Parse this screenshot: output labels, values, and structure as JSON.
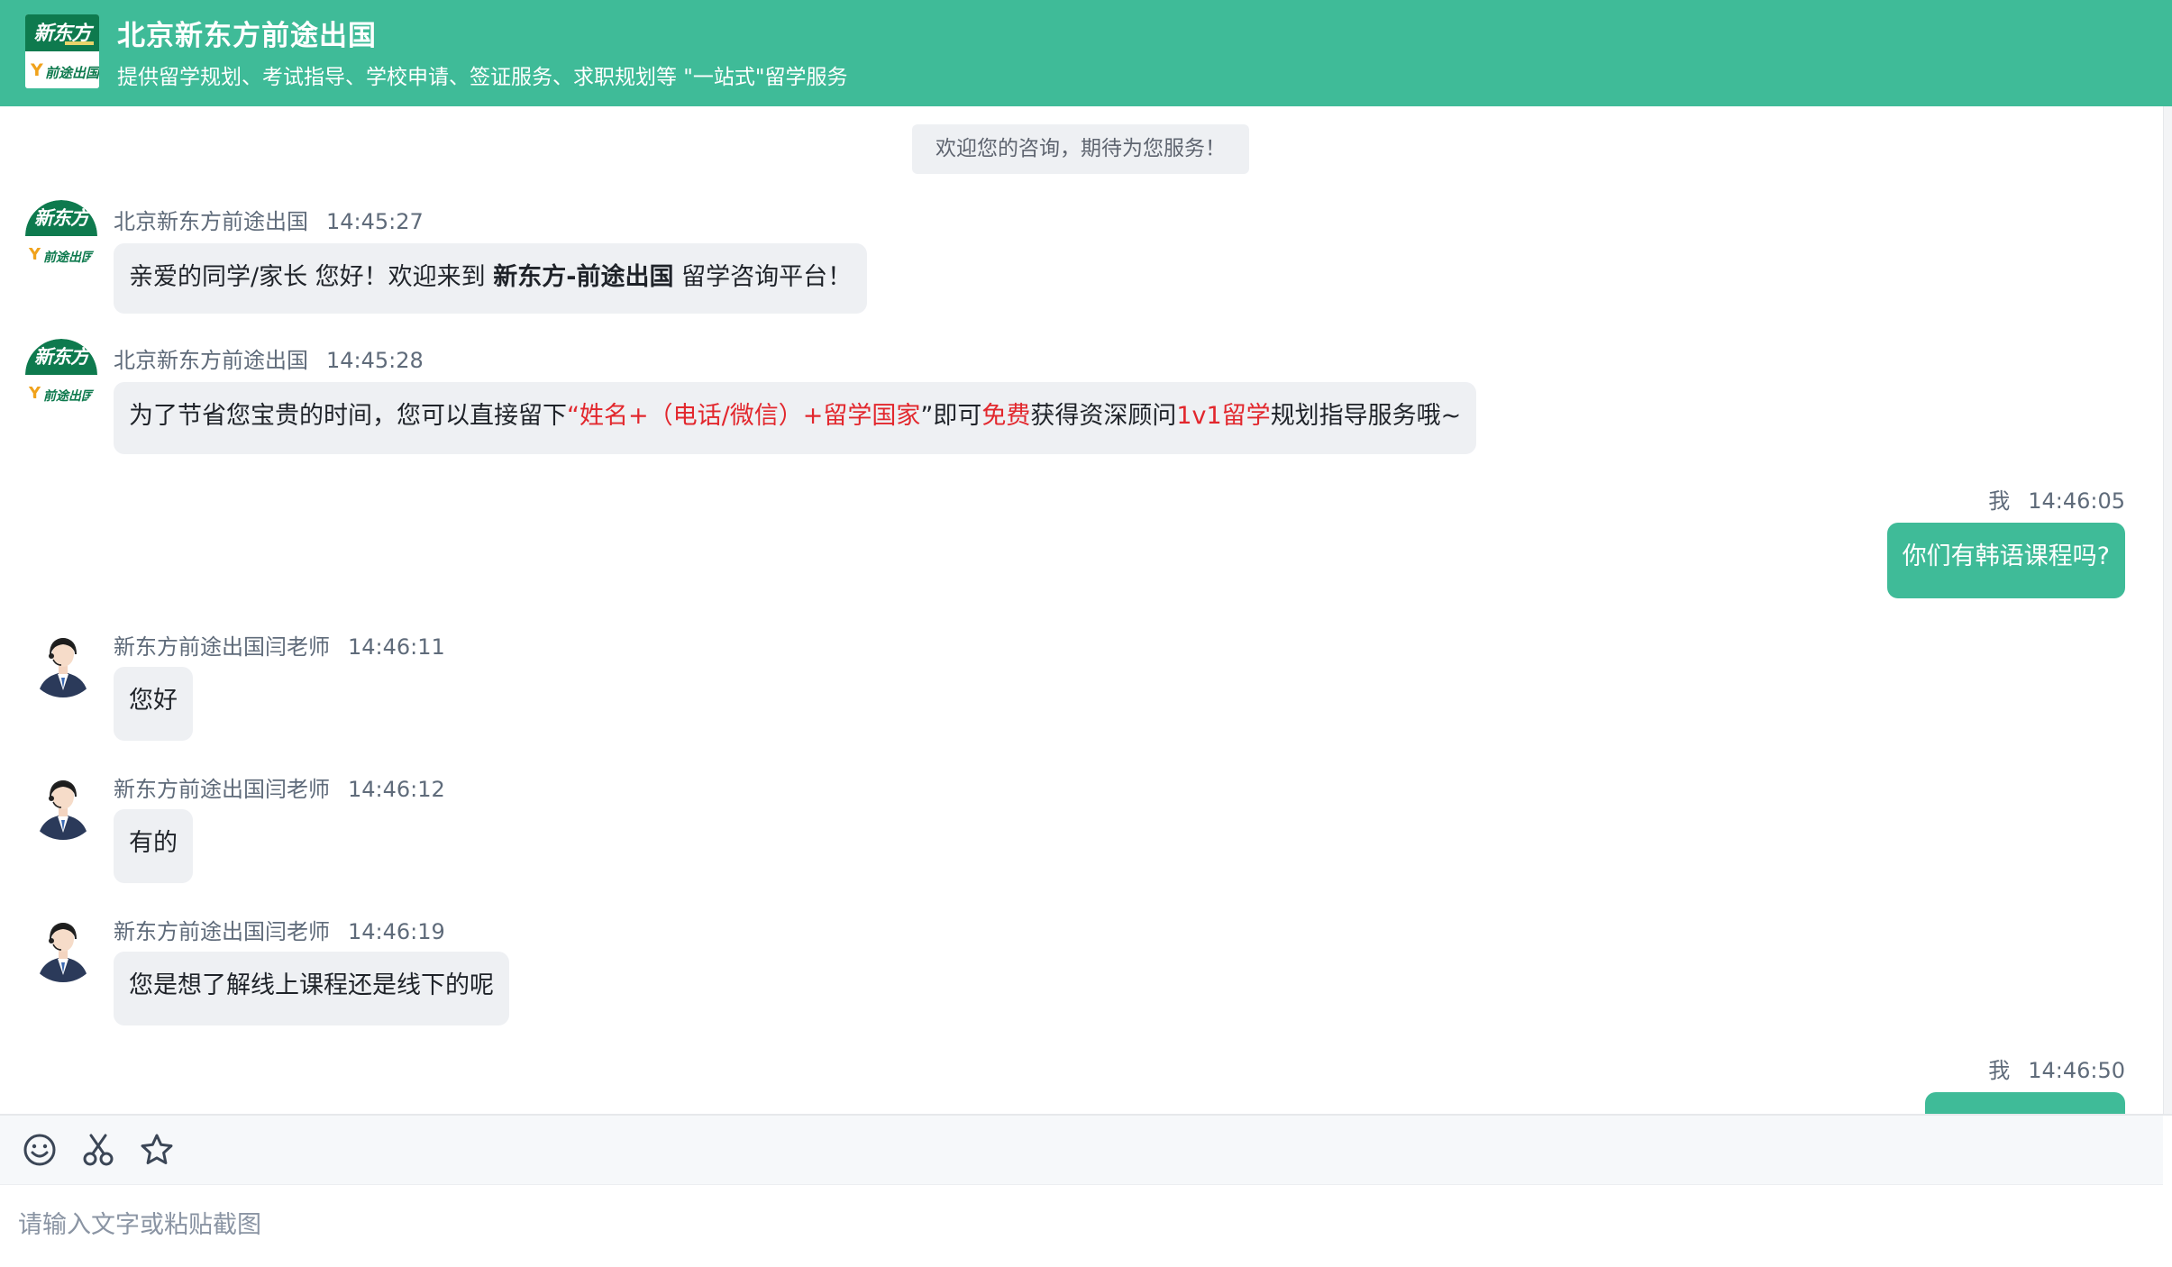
{
  "header": {
    "title": "北京新东方前途出国",
    "subtitle": "提供留学规划、考试指导、学校申请、签证服务、求职规划等 \"一站式\"留学服务",
    "logo": {
      "brand": "新东方",
      "sub": "前途出国"
    }
  },
  "colors": {
    "accent": "#3fbb98",
    "logo_green": "#0e7a4e",
    "highlight_red": "#e2272d",
    "bubble_in": "#eef0f3"
  },
  "chat": {
    "notice": "欢迎您的咨询，期待为您服务！",
    "messages": [
      {
        "direction": "in",
        "sender": "北京新东方前途出国",
        "time": "14:45:27",
        "avatar": "org-logo-avatar",
        "segments": [
          {
            "text": "亲爱的同学/家长 您好！欢迎来到 "
          },
          {
            "text": "新东方-前途出国",
            "style": "bold"
          },
          {
            "text": " 留学咨询平台！"
          }
        ]
      },
      {
        "direction": "in",
        "sender": "北京新东方前途出国",
        "time": "14:45:28",
        "avatar": "org-logo-avatar",
        "segments": [
          {
            "text": "为了节省您宝贵的时间，您可以直接留下"
          },
          {
            "text": "“姓名+（电话/微信）+留学国家",
            "style": "red"
          },
          {
            "text": "”即可"
          },
          {
            "text": "免费",
            "style": "red"
          },
          {
            "text": "获得资深顾问"
          },
          {
            "text": "1v1留学",
            "style": "red"
          },
          {
            "text": "规划指导服务哦~"
          }
        ]
      },
      {
        "direction": "out",
        "sender": "我",
        "time": "14:46:05",
        "text": "你们有韩语课程吗?"
      },
      {
        "direction": "in",
        "sender": "新东方前途出国闫老师",
        "time": "14:46:11",
        "avatar": "agent-avatar",
        "text": "您好"
      },
      {
        "direction": "in",
        "sender": "新东方前途出国闫老师",
        "time": "14:46:12",
        "avatar": "agent-avatar",
        "text": "有的"
      },
      {
        "direction": "in",
        "sender": "新东方前途出国闫老师",
        "time": "14:46:19",
        "avatar": "agent-avatar",
        "text": "您是想了解线上课程还是线下的呢"
      },
      {
        "direction": "out",
        "sender": "我",
        "time": "14:46:50",
        "text": ""
      }
    ]
  },
  "composer": {
    "tools": [
      "emoji-icon",
      "scissors-icon",
      "star-icon"
    ],
    "placeholder": "请输入文字或粘贴截图",
    "value": ""
  }
}
